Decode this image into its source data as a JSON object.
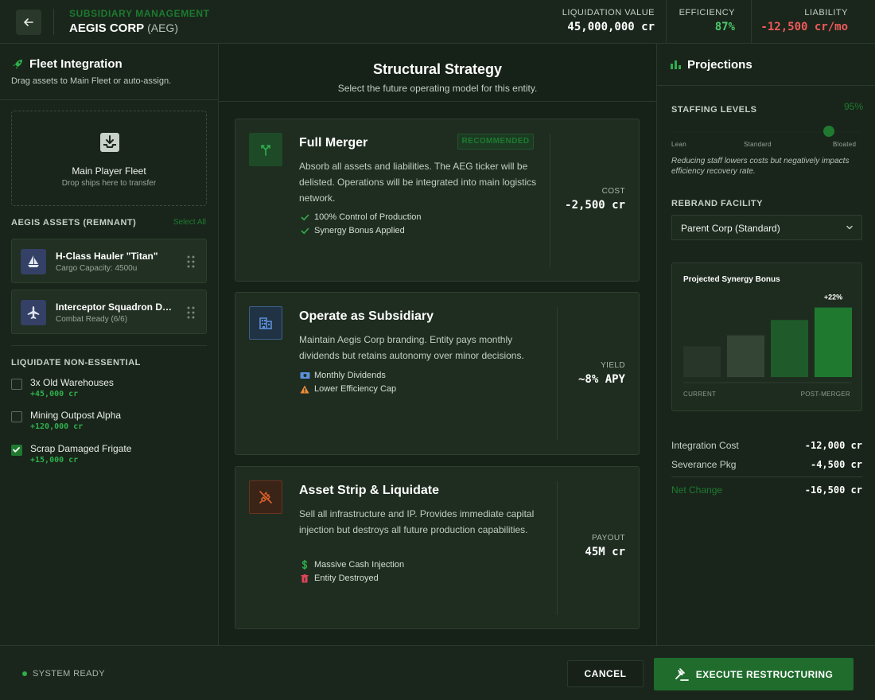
{
  "header": {
    "subtitle": "SUBSIDIARY MANAGEMENT",
    "title": "AEGIS CORP",
    "ticker": "(AEG)",
    "metrics": [
      {
        "label": "LIQUIDATION VALUE",
        "value": "45,000,000 cr",
        "color": "#ffffff"
      },
      {
        "label": "EFFICIENCY",
        "value": "87%",
        "color": "#4cc86a"
      },
      {
        "label": "LIABILITY",
        "value": "-12,500 cr/mo",
        "color": "#ef5a5a"
      }
    ]
  },
  "left": {
    "title": "Fleet Integration",
    "desc": "Drag assets to Main Fleet or auto-assign.",
    "dropzone": {
      "title": "Main Player Fleet",
      "sub": "Drop ships here to transfer"
    },
    "assets_label": "AEGIS ASSETS (REMNANT)",
    "select_all": "Select All",
    "assets": [
      {
        "name": "H-Class Hauler \"Titan\"",
        "sub": "Cargo Capacity: 4500u",
        "icon": "sailboat-icon"
      },
      {
        "name": "Interceptor Squadron Delta",
        "sub": "Combat Ready (6/6)",
        "icon": "airplane-icon"
      }
    ],
    "liquidate_label": "LIQUIDATE NON-ESSENTIAL",
    "liquidate": [
      {
        "name": "3x Old Warehouses",
        "amount": "+45,000 cr",
        "checked": false
      },
      {
        "name": "Mining Outpost Alpha",
        "amount": "+120,000 cr",
        "checked": false
      },
      {
        "name": "Scrap Damaged Frigate",
        "amount": "+15,000 cr",
        "checked": true
      }
    ]
  },
  "center": {
    "title": "Structural Strategy",
    "subtitle": "Select the future operating model for this entity.",
    "cards": [
      {
        "title": "Full Merger",
        "badge": "RECOMMENDED",
        "desc": "Absorb all assets and liabilities. The AEG ticker will be delisted. Operations will be integrated into main logistics network.",
        "features": [
          {
            "icon": "check-icon",
            "text": "100% Control of Production"
          },
          {
            "icon": "check-icon",
            "text": "Synergy Bonus Applied"
          }
        ],
        "value_label": "COST",
        "value": "-2,500 cr",
        "icon": "merge-icon",
        "accent": "#1f7a30"
      },
      {
        "title": "Operate as Subsidiary",
        "badge": "",
        "desc": "Maintain Aegis Corp branding. Entity pays monthly dividends but retains autonomy over minor decisions.",
        "features": [
          {
            "icon": "cash-icon",
            "text": "Monthly Dividends"
          },
          {
            "icon": "warning-icon",
            "text": "Lower Efficiency Cap"
          }
        ],
        "value_label": "YIELD",
        "value": "~8% APY",
        "icon": "building-icon",
        "accent": "#4a78c8"
      },
      {
        "title": "Asset Strip & Liquidate",
        "badge": "",
        "desc": "Sell all infrastructure and IP. Provides immediate capital injection but destroys all future production capabilities.",
        "features": [
          {
            "icon": "dollar-icon",
            "text": "Massive Cash Injection"
          },
          {
            "icon": "trash-icon",
            "text": "Entity Destroyed"
          }
        ],
        "value_label": "PAYOUT",
        "value": "45M cr",
        "icon": "unplug-icon",
        "accent": "#d35a2a"
      }
    ]
  },
  "right": {
    "title": "Projections",
    "staffing_label": "STAFFING LEVELS",
    "staffing_value": "95%",
    "staffing_level": 0.83,
    "slider_labels": [
      "Lean",
      "Standard",
      "Bloated"
    ],
    "staffing_note": "Reducing staff lowers costs but negatively impacts efficiency recovery rate.",
    "rebrand_label": "REBRAND FACILITY",
    "rebrand_value": "Parent Corp (Standard)",
    "summary": [
      {
        "label": "Integration Cost",
        "value": "-12,000 cr"
      },
      {
        "label": "Severance Pkg",
        "value": "-4,500 cr"
      }
    ],
    "net_label": "Net Change",
    "net_value": "-16,500 cr"
  },
  "chart_data": {
    "type": "bar",
    "title": "Projected Synergy Bonus",
    "categories": [
      "CURRENT",
      "",
      "",
      "POST-MERGER"
    ],
    "values": [
      42,
      57,
      78,
      95
    ],
    "ylim": [
      0,
      100
    ],
    "annotation": "+22%",
    "colors": [
      "#283629",
      "#344536",
      "#1f5a2a",
      "#1f7a30"
    ]
  },
  "footer": {
    "status": "SYSTEM READY",
    "cancel": "CANCEL",
    "execute": "EXECUTE RESTRUCTURING"
  }
}
